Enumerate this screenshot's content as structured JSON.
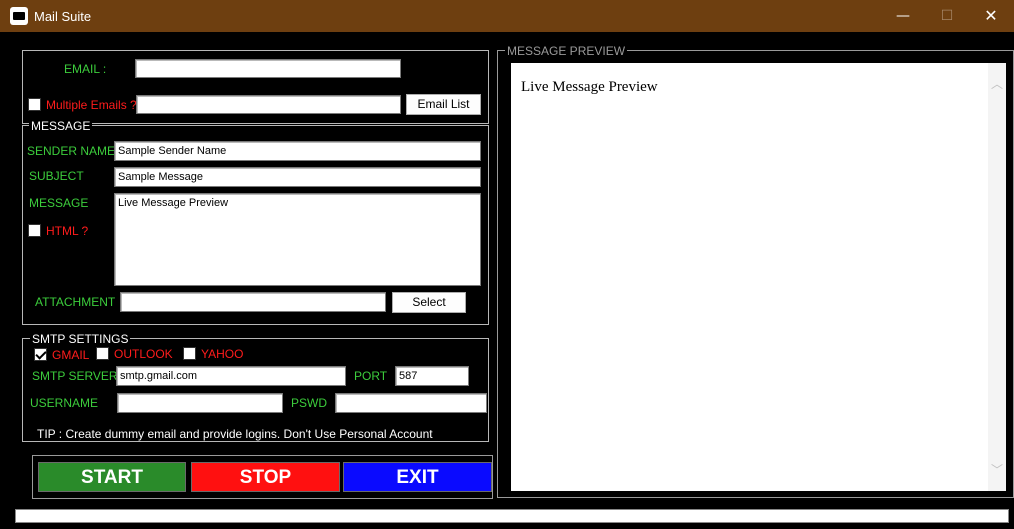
{
  "window": {
    "title": "Mail Suite",
    "minimize_glyph": "—",
    "maximize_glyph": "☐",
    "close_glyph": "✕",
    "icon": "mail-envelope-icon"
  },
  "recipient": {
    "email_label": "EMAIL :",
    "email_value": "",
    "multiple_label": "Multiple Emails ?",
    "multiple_checked": false,
    "multiple_value": "",
    "email_list_button": "Email List"
  },
  "message": {
    "legend": "MESSAGE",
    "sender_label": "SENDER NAME",
    "sender_value": "Sample Sender Name",
    "subject_label": "SUBJECT",
    "subject_value": "Sample Message",
    "message_label": "MESSAGE",
    "message_value": "Live Message Preview",
    "html_label": "HTML ?",
    "html_checked": false,
    "attachment_label": "ATTACHMENT",
    "attachment_value": "",
    "select_button": "Select"
  },
  "smtp": {
    "legend": "SMTP SETTINGS",
    "providers": [
      {
        "label": "GMAIL",
        "checked": true
      },
      {
        "label": "OUTLOOK",
        "checked": false
      },
      {
        "label": "YAHOO",
        "checked": false
      }
    ],
    "server_label": "SMTP SERVER",
    "server_value": "smtp.gmail.com",
    "port_label": "PORT",
    "port_value": "587",
    "username_label": "USERNAME",
    "username_value": "",
    "password_label": "PSWD",
    "password_value": "",
    "tip": "TIP : Create dummy email and provide logins. Don't Use Personal Account"
  },
  "actions": {
    "start": "START",
    "stop": "STOP",
    "exit": "EXIT"
  },
  "preview": {
    "legend": "MESSAGE PREVIEW",
    "content": "Live Message Preview",
    "scroll_up_glyph": "︿",
    "scroll_down_glyph": "﹀"
  },
  "colors": {
    "titlebar": "#6e3f10",
    "label_green": "#3ccd3c",
    "label_red": "#ff1c1c",
    "start": "#2a8b2a",
    "stop": "#ff1010",
    "exit": "#0a0aff"
  }
}
